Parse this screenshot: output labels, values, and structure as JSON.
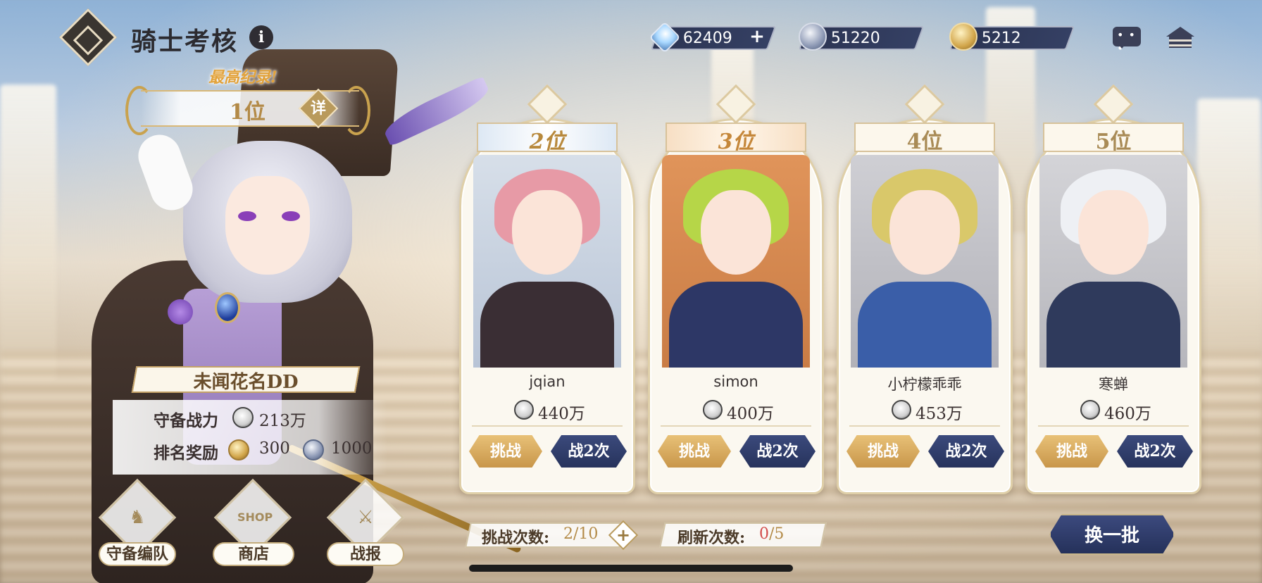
{
  "header": {
    "title": "骑士考核",
    "info_icon": "info-icon",
    "currencies": [
      {
        "icon": "diamond-icon",
        "value": "62409",
        "has_plus": true
      },
      {
        "icon": "silver-medal-icon",
        "value": "51220"
      },
      {
        "icon": "gold-medal-icon",
        "value": "5212"
      }
    ],
    "chat_icon": "chat-icon",
    "home_icon": "home-icon"
  },
  "best_record": {
    "label": "最高纪录!",
    "rank": "1位",
    "detail_label": "详"
  },
  "player": {
    "name": "未闻花名DD",
    "defense_power_label": "守备战力",
    "defense_power_value": "213万",
    "rank_reward_label": "排名奖励",
    "rank_reward_gold": "300",
    "rank_reward_silver": "1000"
  },
  "side_menu": [
    {
      "label": "守备编队",
      "icon": "knight-chess-icon"
    },
    {
      "label": "商店",
      "icon": "shop-icon"
    },
    {
      "label": "战报",
      "icon": "battle-report-icon"
    }
  ],
  "opponents": [
    {
      "rank": "2位",
      "name": "jqian",
      "power": "440万",
      "challenge_label": "挑战",
      "twice_label": "战2次"
    },
    {
      "rank": "3位",
      "name": "simon",
      "power": "400万",
      "challenge_label": "挑战",
      "twice_label": "战2次"
    },
    {
      "rank": "4位",
      "name": "小柠檬乖乖",
      "power": "453万",
      "challenge_label": "挑战",
      "twice_label": "战2次"
    },
    {
      "rank": "5位",
      "name": "寒蝉",
      "power": "460万",
      "challenge_label": "挑战",
      "twice_label": "战2次"
    }
  ],
  "footer": {
    "challenge_count_label": "挑战次数:",
    "challenge_count_value": "2/10",
    "refresh_count_label": "刷新次数:",
    "refresh_count_used": "0",
    "refresh_count_total": "/5",
    "refresh_button": "换一批"
  },
  "colors": {
    "gold_accent": "#c8964a",
    "navy_button": "#27335c",
    "text_dark": "#3a3030"
  }
}
